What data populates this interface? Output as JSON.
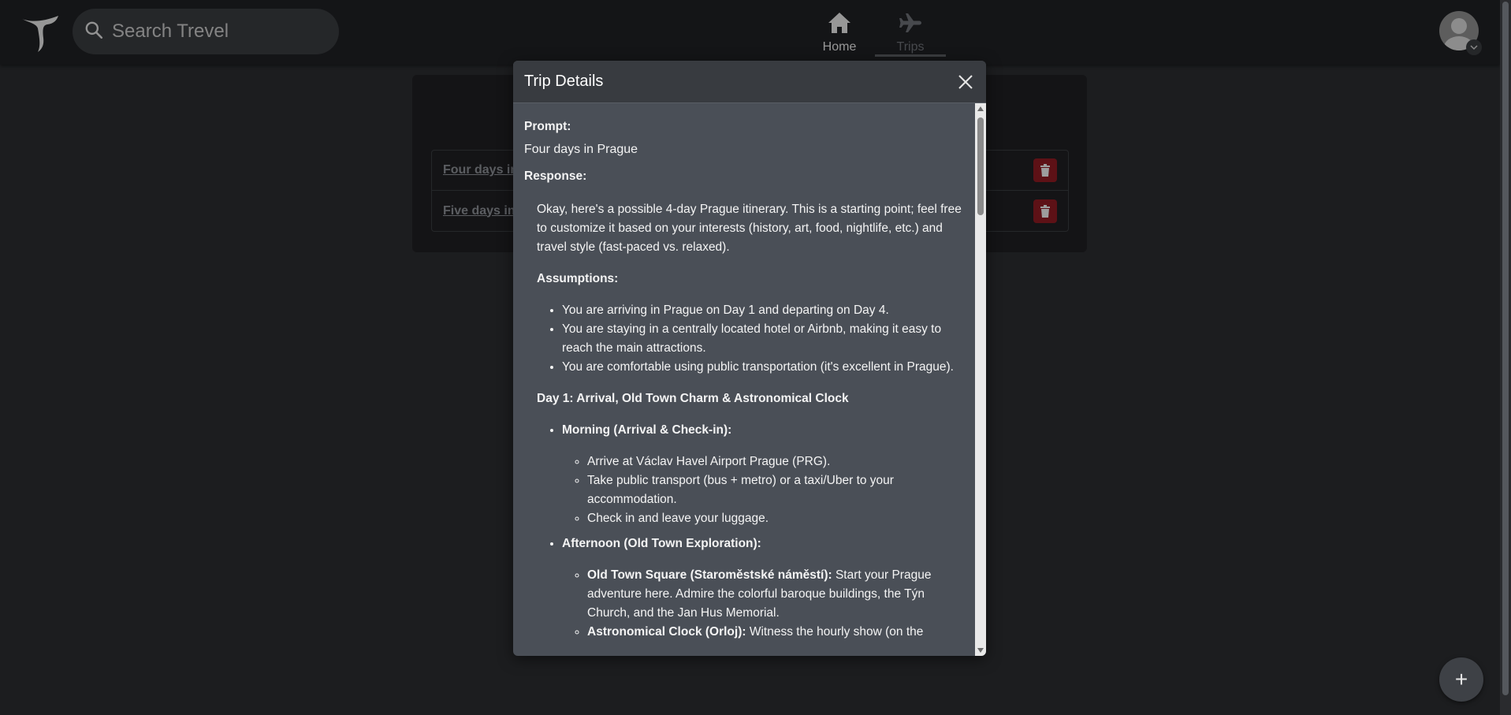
{
  "header": {
    "search_placeholder": "Search Trevel",
    "nav": [
      {
        "label": "Home",
        "icon": "home-icon",
        "active": false
      },
      {
        "label": "Trips",
        "icon": "airplane-icon",
        "active": true
      }
    ]
  },
  "trips": {
    "items": [
      {
        "label": "Four days in"
      },
      {
        "label": "Five days in"
      }
    ]
  },
  "modal": {
    "title": "Trip Details",
    "prompt_label": "Prompt:",
    "prompt_text": "Four days in Prague",
    "response_label": "Response:",
    "response": {
      "intro": "Okay, here's a possible 4-day Prague itinerary. This is a starting point; feel free to customize it based on your interests (history, art, food, nightlife, etc.) and travel style (fast-paced vs. relaxed).",
      "assumptions_title": "Assumptions:",
      "assumptions": [
        "You are arriving in Prague on Day 1 and departing on Day 4.",
        "You are staying in a centrally located hotel or Airbnb, making it easy to reach the main attractions.",
        "You are comfortable using public transportation (it's excellent in Prague)."
      ],
      "day1_title": "Day 1: Arrival, Old Town Charm & Astronomical Clock",
      "morning_title": "Morning (Arrival & Check-in):",
      "morning_items": [
        "Arrive at Václav Havel Airport Prague (PRG).",
        "Take public transport (bus + metro) or a taxi/Uber to your accommodation.",
        "Check in and leave your luggage."
      ],
      "afternoon_title": "Afternoon (Old Town Exploration):",
      "afternoon_items": [
        {
          "strong": "Old Town Square (Staroměstské náměstí):",
          "text": " Start your Prague adventure here. Admire the colorful baroque buildings, the Týn Church, and the Jan Hus Memorial."
        },
        {
          "strong": "Astronomical Clock (Orloj):",
          "text": " Witness the hourly show (on the"
        }
      ]
    }
  },
  "fab": {
    "label": "+"
  },
  "colors": {
    "background": "#2b2d30",
    "topbar": "#202124",
    "modal": "#4a4f57",
    "delete": "#8f1b22"
  }
}
